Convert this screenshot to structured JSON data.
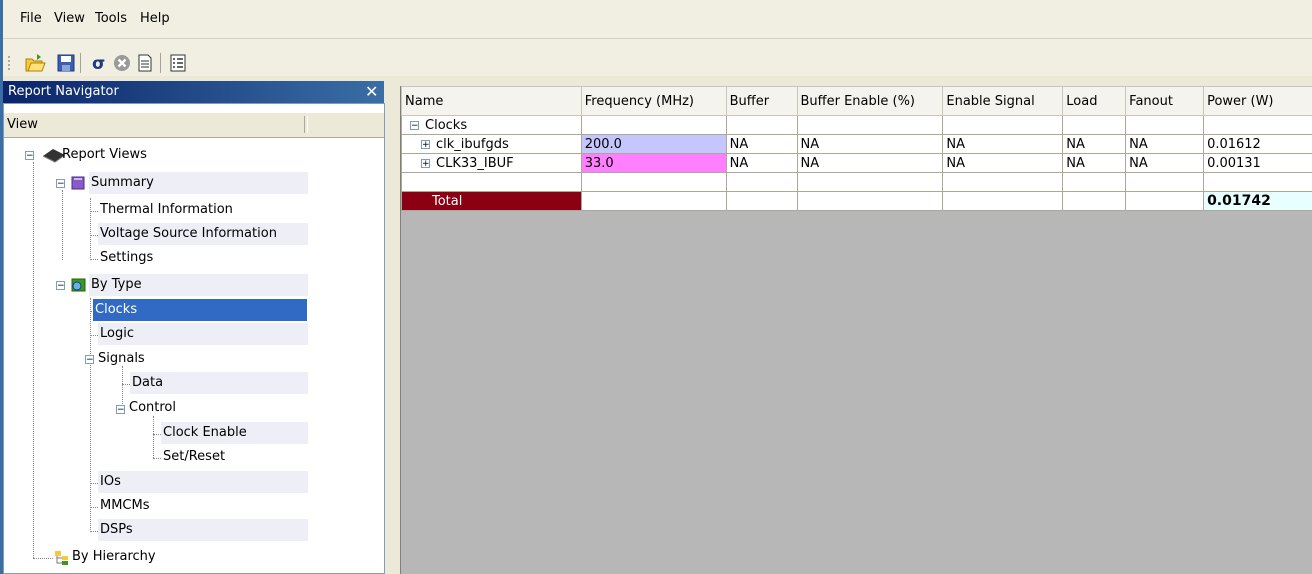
{
  "menu": [
    "File",
    "View",
    "Tools",
    "Help"
  ],
  "toolbar": {
    "icons": [
      "open-folder-icon",
      "save-icon",
      "sigma-icon",
      "stop-icon",
      "document-icon",
      "list-view-icon"
    ]
  },
  "navigator": {
    "title": "Report Navigator",
    "close_glyph": "✕",
    "column_header": "View",
    "tree": {
      "report_views": "Report Views",
      "summary": "Summary",
      "thermal": "Thermal Information",
      "voltage": "Voltage Source Information",
      "settings": "Settings",
      "by_type": "By Type",
      "clocks": "Clocks",
      "logic": "Logic",
      "signals": "Signals",
      "data": "Data",
      "control": "Control",
      "clock_enable": "Clock Enable",
      "set_reset": "Set/Reset",
      "ios": "IOs",
      "mmcms": "MMCMs",
      "dsps": "DSPs",
      "by_hierarchy": "By Hierarchy"
    }
  },
  "grid": {
    "columns": [
      "Name",
      "Frequency (MHz)",
      "Buffer",
      "Buffer Enable (%)",
      "Enable Signal",
      "Load",
      "Fanout",
      "Power (W)"
    ],
    "group_label": "Clocks",
    "rows": [
      {
        "name": "clk_ibufgds",
        "frequency": "200.0",
        "buffer": "NA",
        "buffer_enable": "NA",
        "enable_signal": "NA",
        "load": "NA",
        "fanout": "NA",
        "power": "0.01612"
      },
      {
        "name": "CLK33_IBUF",
        "frequency": "33.0",
        "buffer": "NA",
        "buffer_enable": "NA",
        "enable_signal": "NA",
        "load": "NA",
        "fanout": "NA",
        "power": "0.00131"
      }
    ],
    "total_label": "Total",
    "total_power": "0.01742"
  },
  "colors": {
    "freq_blue": "#c6c6ff",
    "freq_pink": "#ff7fff",
    "total_bg": "#8b0012",
    "selection": "#316ac5"
  }
}
